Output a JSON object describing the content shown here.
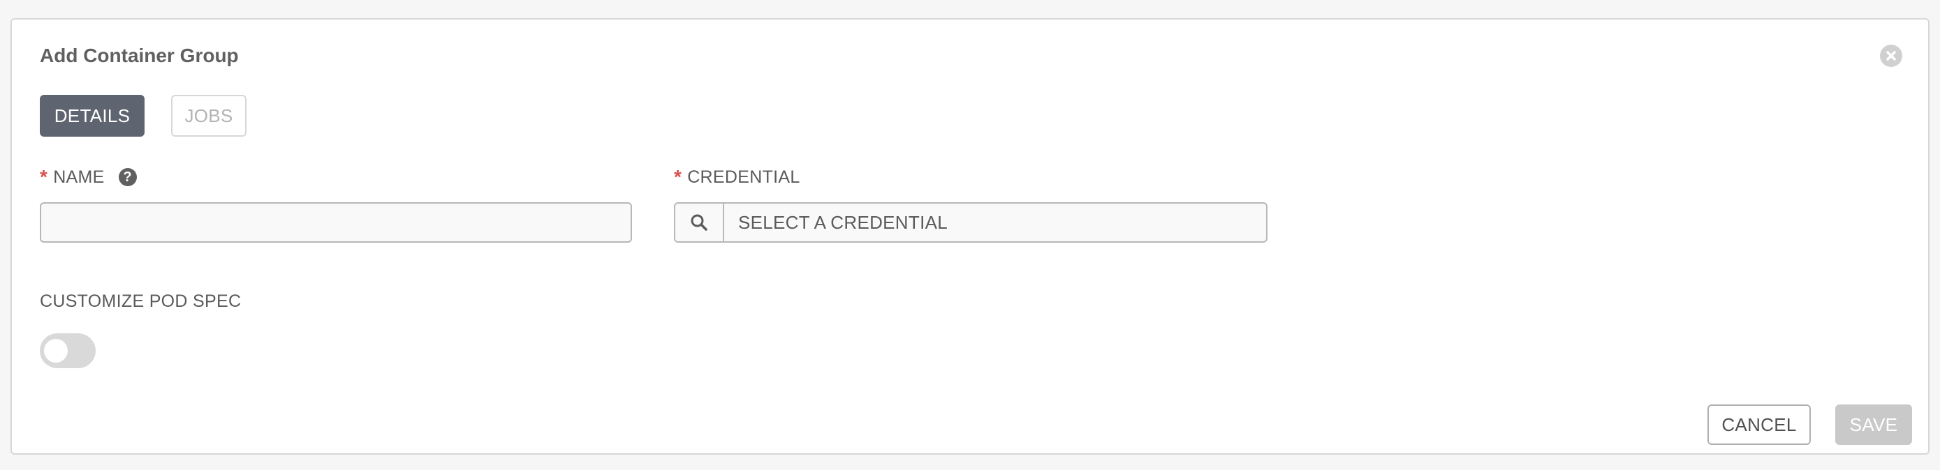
{
  "panel": {
    "title": "Add Container Group"
  },
  "tabs": [
    {
      "label": "DETAILS",
      "active": true
    },
    {
      "label": "JOBS",
      "active": false
    }
  ],
  "form": {
    "name": {
      "required_mark": "*",
      "label": "NAME",
      "help_icon": "question-circle-icon",
      "help_glyph": "?",
      "value": ""
    },
    "credential": {
      "required_mark": "*",
      "label": "CREDENTIAL",
      "search_icon": "search-icon",
      "placeholder": "SELECT A CREDENTIAL"
    },
    "pod_spec": {
      "label": "CUSTOMIZE POD SPEC",
      "enabled": false
    }
  },
  "actions": {
    "cancel_label": "CANCEL",
    "save_label": "SAVE",
    "save_enabled": false
  },
  "colors": {
    "active_tab": "#5f6570",
    "required": "#d9534f",
    "disabled_button": "#c9c9c9"
  }
}
